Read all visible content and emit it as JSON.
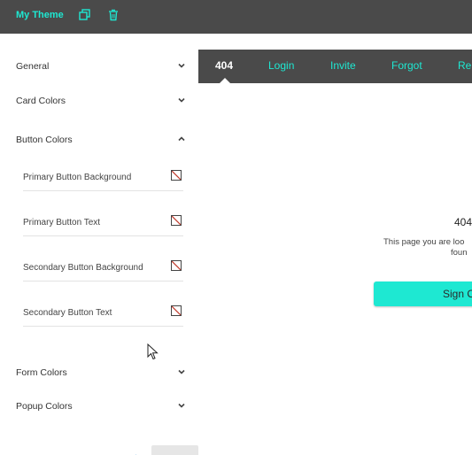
{
  "header": {
    "title": "My Theme",
    "icons": [
      "copy-icon",
      "trash-icon"
    ],
    "accent": "#1ee8d2",
    "background": "#4a4a4a"
  },
  "sidebar": {
    "sections": [
      {
        "label": "General",
        "state": "collapsed"
      },
      {
        "label": "Card Colors",
        "state": "collapsed"
      },
      {
        "label": "Button Colors",
        "state": "expanded"
      },
      {
        "label": "Form Colors",
        "state": "collapsed"
      },
      {
        "label": "Popup Colors",
        "state": "collapsed"
      }
    ],
    "button_colors": [
      {
        "label": "Primary Button Background"
      },
      {
        "label": "Primary Button Text"
      },
      {
        "label": "Secondary Button Background"
      },
      {
        "label": "Secondary Button Text"
      }
    ]
  },
  "preview": {
    "nav": [
      {
        "label": "404",
        "active": true
      },
      {
        "label": "Login"
      },
      {
        "label": "Invite"
      },
      {
        "label": "Forgot"
      },
      {
        "label": "Re"
      }
    ],
    "heading": "404",
    "message_line1": "This page you are loo",
    "message_line2": "foun",
    "button_label": "Sign O",
    "button_color": "#1ee8d2"
  }
}
